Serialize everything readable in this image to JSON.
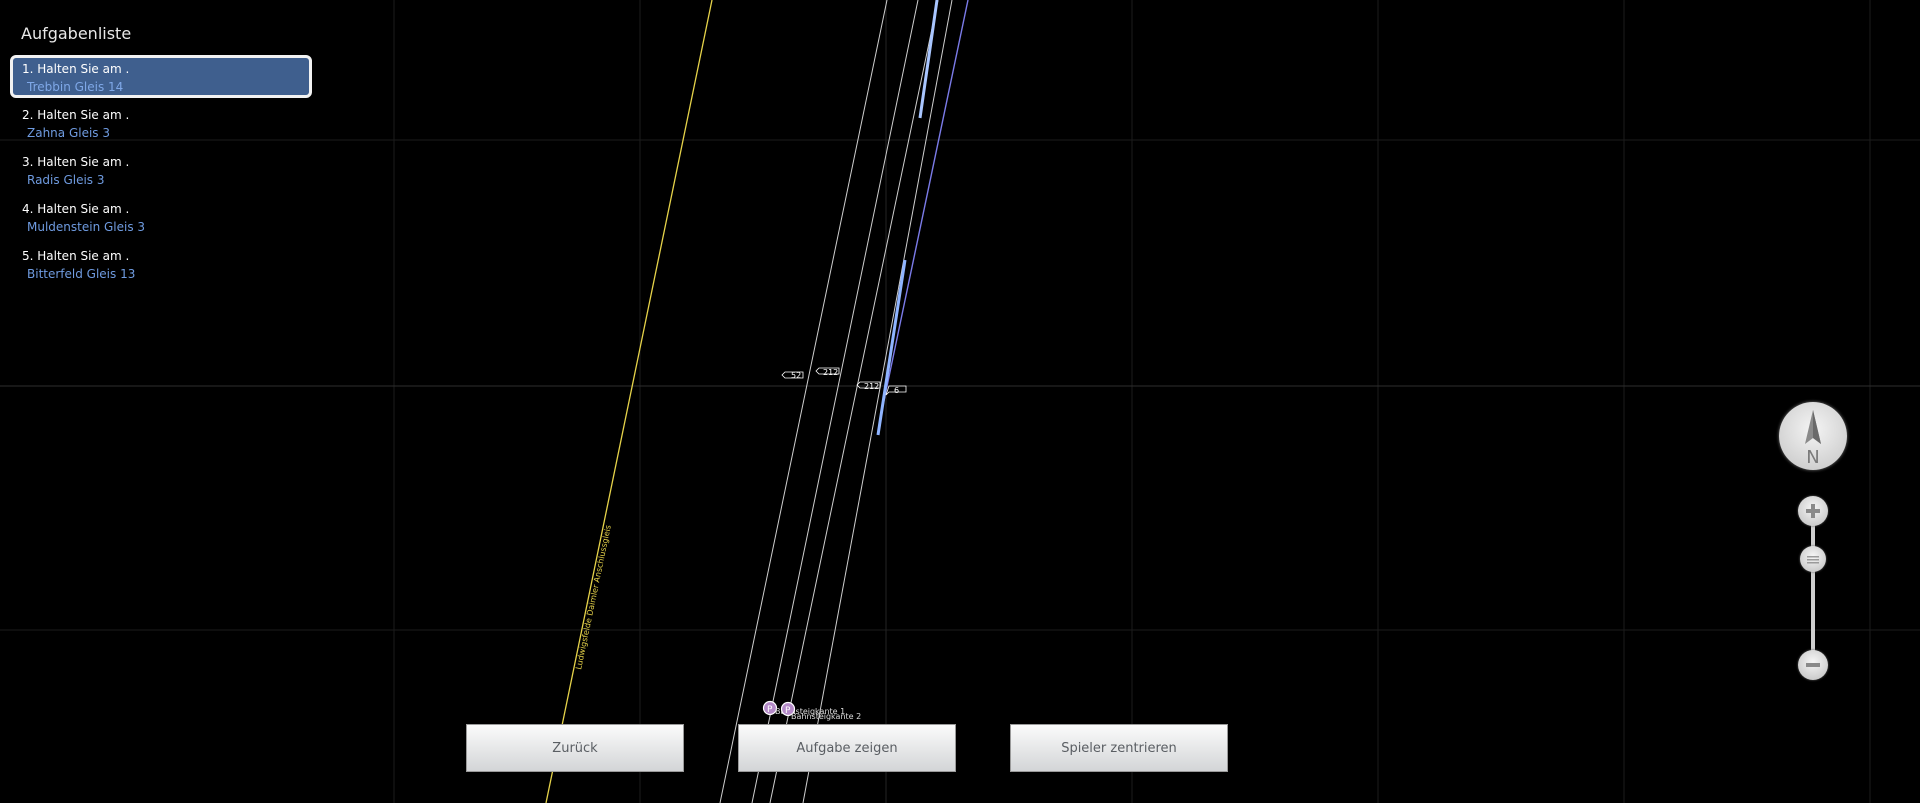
{
  "sidebar": {
    "title": "Aufgabenliste",
    "tasks": [
      {
        "line1": "1. Halten Sie am .",
        "line2": "Trebbin Gleis 14",
        "active": true
      },
      {
        "line1": "2. Halten Sie am .",
        "line2": "Zahna Gleis 3"
      },
      {
        "line1": "3. Halten Sie am .",
        "line2": "Radis Gleis 3"
      },
      {
        "line1": "4. Halten Sie am .",
        "line2": "Muldenstein Gleis 3"
      },
      {
        "line1": "5. Halten Sie am .",
        "line2": "Bitterfeld Gleis 13"
      }
    ]
  },
  "map": {
    "track_label": "Ludwigsfelde Daimler Anschlussgleis",
    "signals": [
      "52",
      "212",
      "212",
      "6"
    ],
    "platform_markers": [
      {
        "icon": "P",
        "label": "Bahnsteigkante 1"
      },
      {
        "icon": "P",
        "label": "Bahnsteigkante 2"
      }
    ],
    "colors": {
      "background": "#000000",
      "grid": "#2a2a2a",
      "siding_track": "#e6d34a",
      "track": "#cfcfcf",
      "active_track": "#8fb4ff",
      "active_route": "#7b7be8"
    }
  },
  "controls": {
    "compass_label": "N",
    "zoom_in": "+",
    "zoom_out": "−",
    "zoom_level": 0.66
  },
  "buttons": {
    "back": "Zurück",
    "show_task": "Aufgabe zeigen",
    "center_player": "Spieler zentrieren"
  }
}
